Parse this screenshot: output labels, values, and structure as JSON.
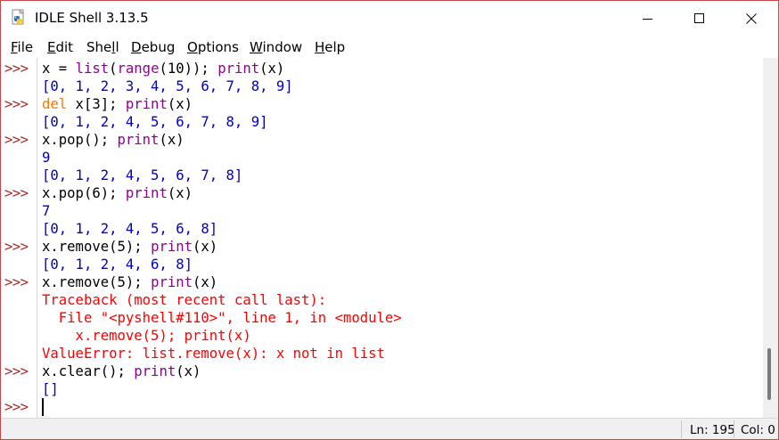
{
  "window": {
    "title": "IDLE Shell 3.13.5",
    "icon": "python-idle-icon"
  },
  "menu": [
    {
      "label": "File",
      "mnemonic": "F",
      "rest": "ile"
    },
    {
      "label": "Edit",
      "mnemonic": "E",
      "rest": "dit"
    },
    {
      "label": "Shell",
      "pre": "She",
      "mnemonic": "l",
      "rest": "l"
    },
    {
      "label": "Debug",
      "mnemonic": "D",
      "rest": "ebug"
    },
    {
      "label": "Options",
      "mnemonic": "O",
      "rest": "ptions"
    },
    {
      "label": "Window",
      "mnemonic": "W",
      "rest": "indow"
    },
    {
      "label": "Help",
      "mnemonic": "H",
      "rest": "elp"
    }
  ],
  "shell": {
    "prompt": ">>>",
    "lines": [
      {
        "prompt": true,
        "parts": [
          [
            "code",
            "x = "
          ],
          [
            "builtin",
            "list"
          ],
          [
            "code",
            "("
          ],
          [
            "builtin",
            "range"
          ],
          [
            "code",
            "(10)); "
          ],
          [
            "builtin",
            "print"
          ],
          [
            "code",
            "(x)"
          ]
        ]
      },
      {
        "prompt": false,
        "parts": [
          [
            "out",
            "[0, 1, 2, 3, 4, 5, 6, 7, 8, 9]"
          ]
        ]
      },
      {
        "prompt": true,
        "parts": [
          [
            "keyword",
            "del"
          ],
          [
            "code",
            " x[3]; "
          ],
          [
            "builtin",
            "print"
          ],
          [
            "code",
            "(x)"
          ]
        ]
      },
      {
        "prompt": false,
        "parts": [
          [
            "out",
            "[0, 1, 2, 4, 5, 6, 7, 8, 9]"
          ]
        ]
      },
      {
        "prompt": true,
        "parts": [
          [
            "code",
            "x.pop(); "
          ],
          [
            "builtin",
            "print"
          ],
          [
            "code",
            "(x)"
          ]
        ]
      },
      {
        "prompt": false,
        "parts": [
          [
            "out",
            "9"
          ]
        ]
      },
      {
        "prompt": false,
        "parts": [
          [
            "out",
            "[0, 1, 2, 4, 5, 6, 7, 8]"
          ]
        ]
      },
      {
        "prompt": true,
        "parts": [
          [
            "code",
            "x.pop(6); "
          ],
          [
            "builtin",
            "print"
          ],
          [
            "code",
            "(x)"
          ]
        ]
      },
      {
        "prompt": false,
        "parts": [
          [
            "out",
            "7"
          ]
        ]
      },
      {
        "prompt": false,
        "parts": [
          [
            "out",
            "[0, 1, 2, 4, 5, 6, 8]"
          ]
        ]
      },
      {
        "prompt": true,
        "parts": [
          [
            "code",
            "x.remove(5); "
          ],
          [
            "builtin",
            "print"
          ],
          [
            "code",
            "(x)"
          ]
        ]
      },
      {
        "prompt": false,
        "parts": [
          [
            "out",
            "[0, 1, 2, 4, 6, 8]"
          ]
        ]
      },
      {
        "prompt": true,
        "parts": [
          [
            "code",
            "x.remove(5); "
          ],
          [
            "builtin",
            "print"
          ],
          [
            "code",
            "(x)"
          ]
        ]
      },
      {
        "prompt": false,
        "parts": [
          [
            "err",
            "Traceback (most recent call last):"
          ]
        ]
      },
      {
        "prompt": false,
        "parts": [
          [
            "err",
            "  File \"<pyshell#110>\", line 1, in <module>"
          ]
        ]
      },
      {
        "prompt": false,
        "parts": [
          [
            "err",
            "    x.remove(5); print(x)"
          ]
        ]
      },
      {
        "prompt": false,
        "parts": [
          [
            "err",
            "ValueError: list.remove(x): x not in list"
          ]
        ]
      },
      {
        "prompt": true,
        "parts": [
          [
            "code",
            "x.clear(); "
          ],
          [
            "builtin",
            "print"
          ],
          [
            "code",
            "(x)"
          ]
        ]
      },
      {
        "prompt": false,
        "parts": [
          [
            "out",
            "[]"
          ]
        ]
      },
      {
        "prompt": true,
        "parts": [],
        "cursor": true
      }
    ]
  },
  "status": {
    "line": "Ln: 195",
    "col": "Col: 0"
  },
  "colors": {
    "prompt": "#a52a2a",
    "builtin": "#900090",
    "keyword": "#ff7700",
    "stdout": "#0000c0",
    "stderr": "#ff0000",
    "border": "#c8464c"
  }
}
